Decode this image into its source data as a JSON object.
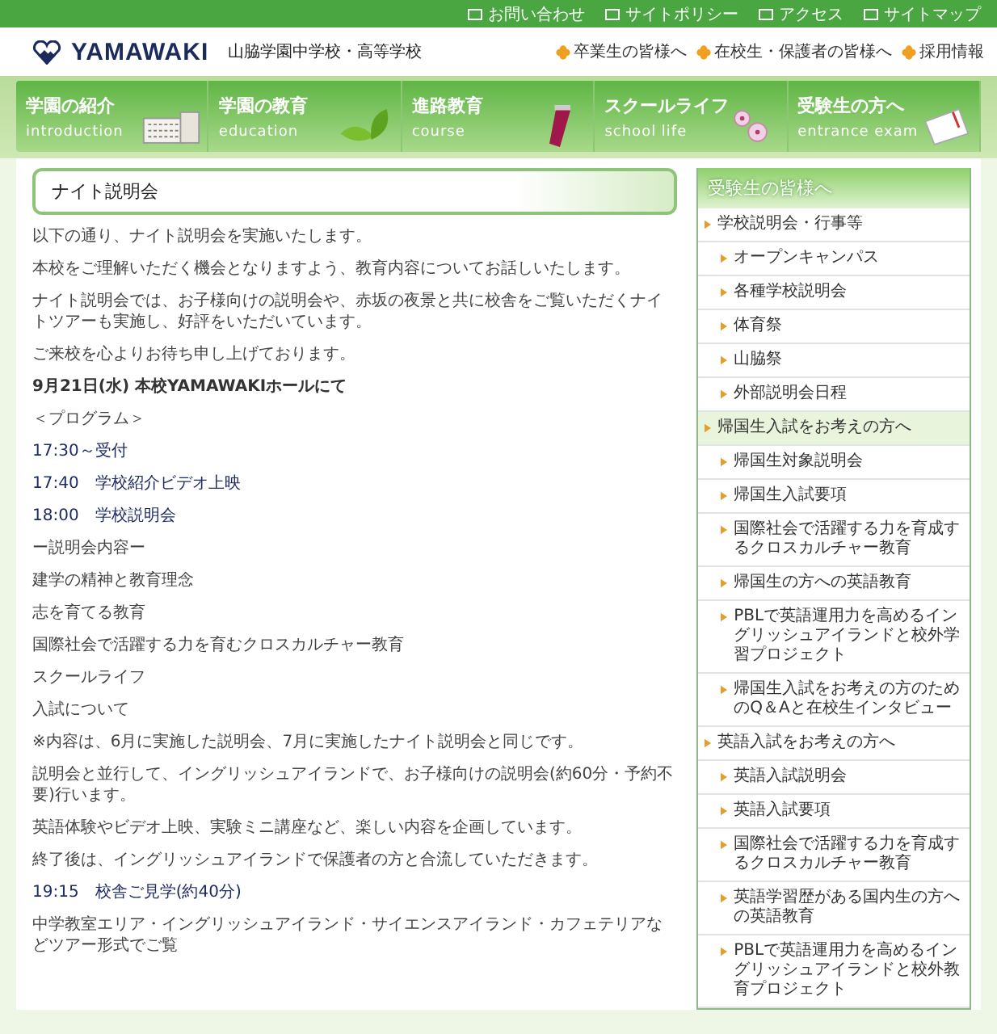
{
  "utility_links": [
    "お問い合わせ",
    "サイトポリシー",
    "アクセス",
    "サイトマップ"
  ],
  "header": {
    "logo": "YAMAWAKI",
    "school_name": "山脇学園中学校・高等学校",
    "links": [
      "卒業生の皆様へ",
      "在校生・保護者の皆様へ",
      "採用情報"
    ]
  },
  "nav": [
    {
      "label": "学園の紹介",
      "sub": "introduction",
      "kind": "building"
    },
    {
      "label": "学園の教育",
      "sub": "education",
      "kind": "leaves"
    },
    {
      "label": "進路教育",
      "sub": "course",
      "kind": "tube"
    },
    {
      "label": "スクールライフ",
      "sub": "school life",
      "kind": "flowers"
    },
    {
      "label": "受験生の方へ",
      "sub": "entrance exam",
      "kind": "notebook"
    }
  ],
  "article": {
    "title": "ナイト説明会",
    "paragraphs": [
      {
        "kind": "text",
        "text": "以下の通り、ナイト説明会を実施いたします。"
      },
      {
        "kind": "text",
        "text": "本校をご理解いただく機会となりますよう、教育内容についてお話しいたします。"
      },
      {
        "kind": "text",
        "text": "ナイト説明会では、お子様向けの説明会や、赤坂の夜景と共に校舎をご覧いただくナイトツアーも実施し、好評をいただいています。"
      },
      {
        "kind": "text",
        "text": "ご来校を心よりお待ち申し上げております。"
      },
      {
        "kind": "date",
        "text": "9月21日(水) 本校YAMAWAKIホールにて"
      },
      {
        "kind": "text",
        "text": "＜プログラム＞"
      },
      {
        "kind": "time",
        "text": "17:30～受付"
      },
      {
        "kind": "time",
        "text": "17:40　学校紹介ビデオ上映"
      },
      {
        "kind": "time",
        "text": "18:00　学校説明会"
      },
      {
        "kind": "text",
        "text": "ー説明会内容ー"
      },
      {
        "kind": "text",
        "text": "建学の精神と教育理念"
      },
      {
        "kind": "text",
        "text": "志を育てる教育"
      },
      {
        "kind": "text",
        "text": "国際社会で活躍する力を育むクロスカルチャー教育"
      },
      {
        "kind": "text",
        "text": "スクールライフ"
      },
      {
        "kind": "text",
        "text": "入試について"
      },
      {
        "kind": "text",
        "text": "※内容は、6月に実施した説明会、7月に実施したナイト説明会と同じです。"
      },
      {
        "kind": "text",
        "text": "説明会と並行して、イングリッシュアイランドで、お子様向けの説明会(約60分・予約不要)行います。"
      },
      {
        "kind": "text",
        "text": "英語体験やビデオ上映、実験ミニ講座など、楽しい内容を企画しています。"
      },
      {
        "kind": "text",
        "text": "終了後は、イングリッシュアイランドで保護者の方と合流していただきます。"
      },
      {
        "kind": "time",
        "text": "19:15　校舎ご見学(約40分)"
      },
      {
        "kind": "text",
        "text": "中学教室エリア・イングリッシュアイランド・サイエンスアイランド・カフェテリアなどツアー形式でご覧"
      }
    ]
  },
  "sidebar": {
    "title": "受験生の皆様へ",
    "items": [
      {
        "label": "学校説明会・行事等",
        "selected": false,
        "children": [
          {
            "label": "オープンキャンパス",
            "selected": false
          },
          {
            "label": "各種学校説明会",
            "selected": false
          },
          {
            "label": "体育祭",
            "selected": false
          },
          {
            "label": "山脇祭",
            "selected": false
          },
          {
            "label": "外部説明会日程",
            "selected": false
          }
        ]
      },
      {
        "label": "帰国生入試をお考えの方へ",
        "selected": true,
        "children": [
          {
            "label": "帰国生対象説明会",
            "selected": false
          },
          {
            "label": "帰国生入試要項",
            "selected": false
          },
          {
            "label": "国際社会で活躍する力を育成するクロスカルチャー教育",
            "selected": false
          },
          {
            "label": "帰国生の方への英語教育",
            "selected": false
          },
          {
            "label": "PBLで英語運用力を高めるイングリッシュアイランドと校外学習プロジェクト",
            "selected": false
          },
          {
            "label": "帰国生入試をお考えの方のためのQ＆Aと在校生インタビュー",
            "selected": false
          }
        ]
      },
      {
        "label": "英語入試をお考えの方へ",
        "selected": false,
        "children": [
          {
            "label": "英語入試説明会",
            "selected": false
          },
          {
            "label": "英語入試要項",
            "selected": false
          },
          {
            "label": "国際社会で活躍する力を育成するクロスカルチャー教育",
            "selected": false
          },
          {
            "label": "英語学習歴がある国内生の方への英語教育",
            "selected": false
          },
          {
            "label": "PBLで英語運用力を高めるイングリッシュアイランドと校外教育プロジェクト",
            "selected": false
          }
        ]
      }
    ]
  }
}
